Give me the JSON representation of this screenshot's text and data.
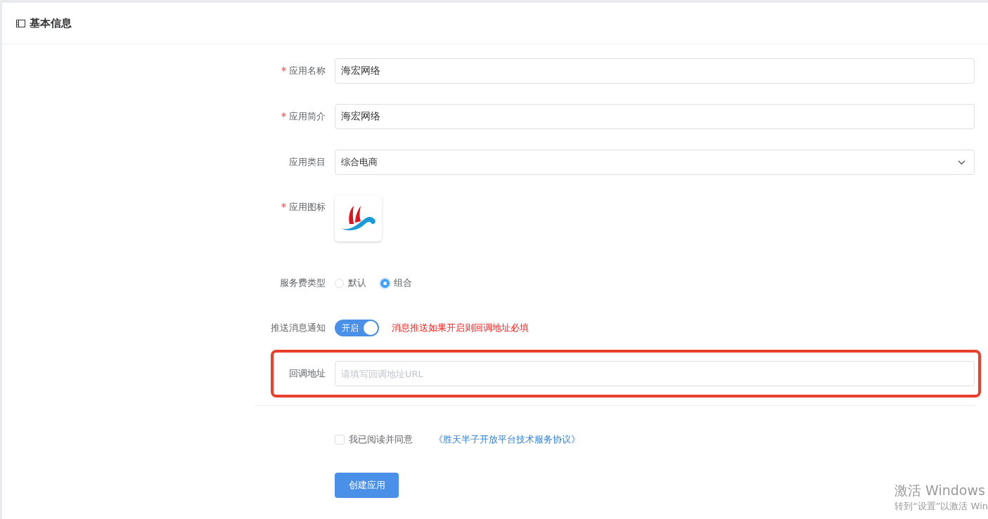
{
  "header": {
    "title": "基本信息"
  },
  "fields": [
    {
      "kind": "text",
      "label": "应用名称",
      "required": true,
      "value": "海宏网络",
      "highlighted": false
    },
    {
      "kind": "text",
      "label": "应用简介",
      "required": true,
      "value": "海宏网络",
      "highlighted": false
    },
    {
      "kind": "select",
      "label": "应用类目",
      "required": false,
      "value": "综合电商"
    },
    {
      "kind": "image",
      "label": "应用图标",
      "required": true
    },
    {
      "kind": "radio",
      "label": "服务费类型",
      "required": false,
      "options": [
        {
          "label": "默认",
          "selected": false
        },
        {
          "label": "组合",
          "selected": true
        }
      ]
    },
    {
      "kind": "switch",
      "label": "推送消息通知",
      "required": false,
      "on": true,
      "switch_text": "开启",
      "hint": "消息推送如果开启则回调地址必填"
    },
    {
      "kind": "text",
      "label": "回调地址",
      "required": false,
      "placeholder": "请填写回调地址URL",
      "highlighted": true
    }
  ],
  "agreement": {
    "checked": false,
    "label": "我已阅读并同意",
    "link": "《胜天半子开放平台技术服务协议》"
  },
  "submit": "创建应用",
  "activation_notice": {
    "title": "激活 Windows",
    "subtitle": "转到“设置”以激活 Win"
  }
}
